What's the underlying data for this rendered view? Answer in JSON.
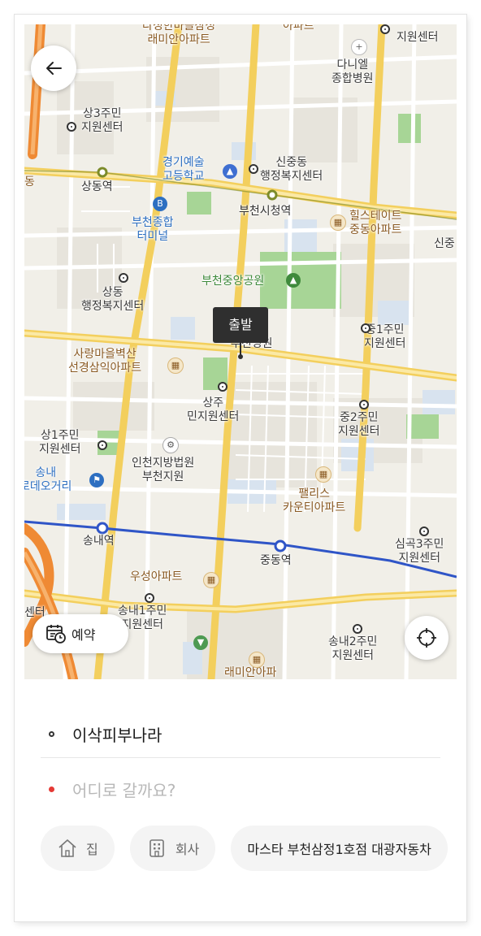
{
  "map": {
    "labels": {
      "top_apt": "다정한마을삼정\n래미안아파트",
      "top_apt2": "아파트",
      "top_right_center": "지원센터",
      "daniel_hospital": "다니엘\n종합병원",
      "sang3": "상3주민\n지원센터",
      "gyeonggi_art": "경기예술\n고등학교",
      "sinjung": "신중동\n행정복지센터",
      "sangdong_stn": "상동역",
      "bucheon_terminal": "부천종합\n터미널",
      "bucheon_cityhall_stn": "부천시청역",
      "hillstate": "힐스테이트\n중동아파트",
      "sinjung_edge": "신중",
      "central_park": "부천중앙공원",
      "sangdong_admin": "상동\n행정복지센터",
      "school_hospital": "학교\n부천병원",
      "jung1": "중1주민\n지원센터",
      "sarangmaeul": "사랑마을벽산\n선경삼익아파트",
      "sangju": "상주\n민지원센터",
      "jung2": "중2주민\n지원센터",
      "sang1": "상1주민\n지원센터",
      "incheon_court": "인천지방법원\n부천지원",
      "songnae_rodeo": "송내\n로데오거리",
      "palace": "팰리스\n카운티아파트",
      "songnae_stn": "송내역",
      "jungdong_stn": "중동역",
      "simgok3": "심곡3주민\n지원센터",
      "useong": "우성아파트",
      "songnae1": "송내1주민\n지원센터",
      "songnae2": "송내2주민\n지원센터",
      "bottom_apt": "래미안아파",
      "left_edge_center": "센터",
      "left_edge_dong": "동"
    },
    "start_marker": "출발",
    "reserve_label": "예약",
    "icons": {
      "back": "arrow-left-icon",
      "locate": "crosshair-icon",
      "reserve": "calendar-clock-icon"
    }
  },
  "route": {
    "origin": "이삭피부나라",
    "destination_placeholder": "어디로 갈까요?"
  },
  "shortcuts": [
    {
      "icon": "home-icon",
      "label": "집"
    },
    {
      "icon": "building-icon",
      "label": "회사"
    },
    {
      "label": "마스타 부천삼정1호점 대광자동차"
    }
  ],
  "colors": {
    "accent_red": "#e53935",
    "road_yellow": "#f6d66b",
    "rail_blue": "#2f55c7",
    "park_green": "#9ccf8c"
  }
}
